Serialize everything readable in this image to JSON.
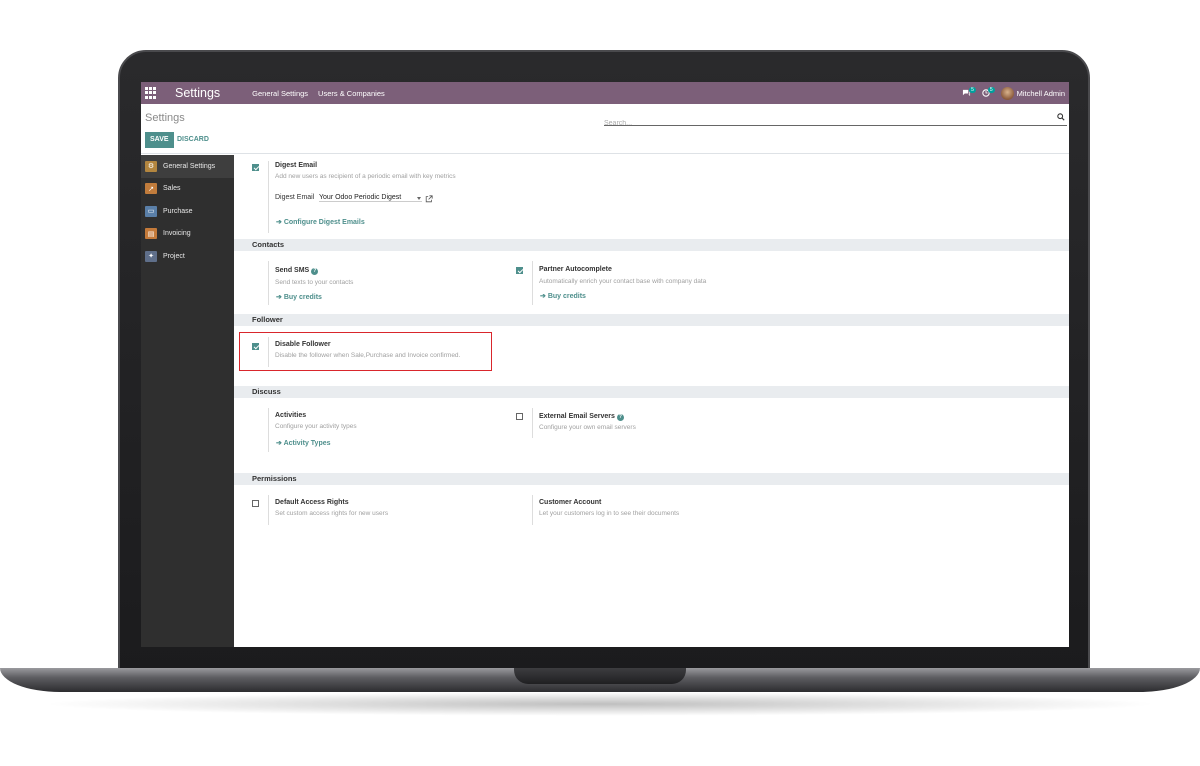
{
  "navbar": {
    "brand": "Settings",
    "menu": [
      "General Settings",
      "Users & Companies"
    ],
    "messages_count": "5",
    "activities_count": "5",
    "user_name": "Mitchell Admin"
  },
  "control_panel": {
    "title": "Settings",
    "search_placeholder": "Search...",
    "save_label": "SAVE",
    "discard_label": "DISCARD"
  },
  "sidebar": {
    "items": [
      {
        "label": "General Settings",
        "icon": "settings-app-icon",
        "color": "#b3863f"
      },
      {
        "label": "Sales",
        "icon": "sales-app-icon",
        "color": "#c17c3c"
      },
      {
        "label": "Purchase",
        "icon": "purchase-app-icon",
        "color": "#5a7fa8"
      },
      {
        "label": "Invoicing",
        "icon": "invoicing-app-icon",
        "color": "#c47a3a"
      },
      {
        "label": "Project",
        "icon": "project-app-icon",
        "color": "#5f6f8a"
      }
    ]
  },
  "digest": {
    "title": "Digest Email",
    "desc": "Add new users as recipient of a periodic email with key metrics",
    "field_label": "Digest Email",
    "field_value": "Your Odoo Periodic Digest",
    "link": "Configure Digest Emails",
    "checked": true
  },
  "contacts": {
    "header": "Contacts",
    "send_sms_title": "Send SMS",
    "send_sms_desc": "Send texts to your contacts",
    "send_sms_link": "Buy credits",
    "partner_title": "Partner Autocomplete",
    "partner_desc": "Automatically enrich your contact base with company data",
    "partner_link": "Buy credits",
    "partner_checked": true
  },
  "follower": {
    "header": "Follower",
    "title": "Disable Follower",
    "desc": "Disable the follower when Sale,Purchase and Invoice confirmed.",
    "checked": true
  },
  "discuss": {
    "header": "Discuss",
    "activities_title": "Activities",
    "activities_desc": "Configure your activity types",
    "activities_link": "Activity Types",
    "email_title": "External Email Servers",
    "email_desc": "Configure your own email servers",
    "email_checked": false
  },
  "permissions": {
    "header": "Permissions",
    "access_title": "Default Access Rights",
    "access_desc": "Set custom access rights for new users",
    "access_checked": false,
    "customer_title": "Customer Account",
    "customer_desc": "Let your customers log in to see their documents"
  }
}
